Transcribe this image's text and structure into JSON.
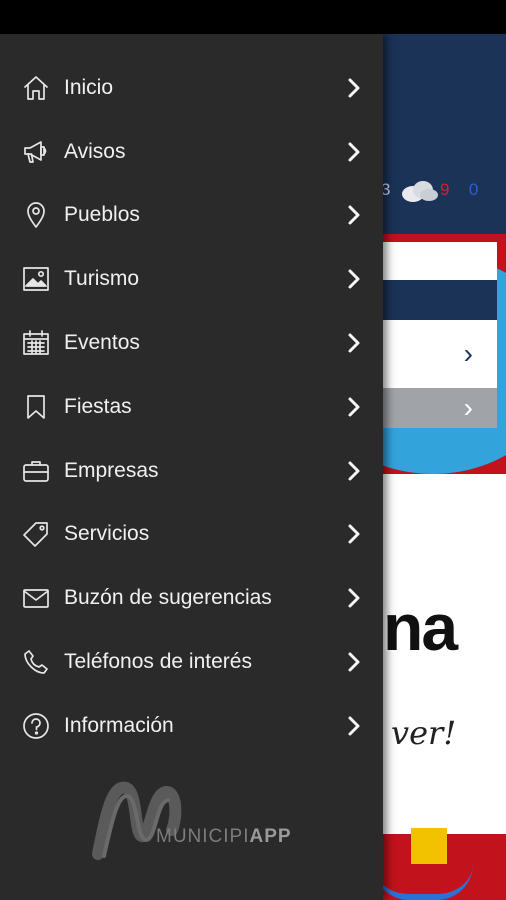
{
  "menu": {
    "items": [
      {
        "label": "Inicio",
        "icon": "home-icon"
      },
      {
        "label": "Avisos",
        "icon": "megaphone-icon"
      },
      {
        "label": "Pueblos",
        "icon": "map-pin-icon"
      },
      {
        "label": "Turismo",
        "icon": "image-icon"
      },
      {
        "label": "Eventos",
        "icon": "calendar-icon"
      },
      {
        "label": "Fiestas",
        "icon": "bookmark-icon"
      },
      {
        "label": "Empresas",
        "icon": "briefcase-icon"
      },
      {
        "label": "Servicios",
        "icon": "tag-icon"
      },
      {
        "label": "Buzón de sugerencias",
        "icon": "mail-icon"
      },
      {
        "label": "Teléfonos de interés",
        "icon": "phone-icon"
      },
      {
        "label": "Información",
        "icon": "help-circle-icon"
      }
    ]
  },
  "footer": {
    "logo_prefix": "MUNICIPI",
    "logo_suffix": "APP"
  },
  "background": {
    "weather_left": "3",
    "weather_red": "9",
    "weather_blue": "0",
    "brand_fragment": "na",
    "slogan_fragment": "ver!"
  },
  "colors": {
    "drawer": "#2a2a2a",
    "text": "#f0f0f0",
    "bg_navy": "#1b3357",
    "bg_red": "#c2121c",
    "bg_blue": "#33a3dc"
  }
}
